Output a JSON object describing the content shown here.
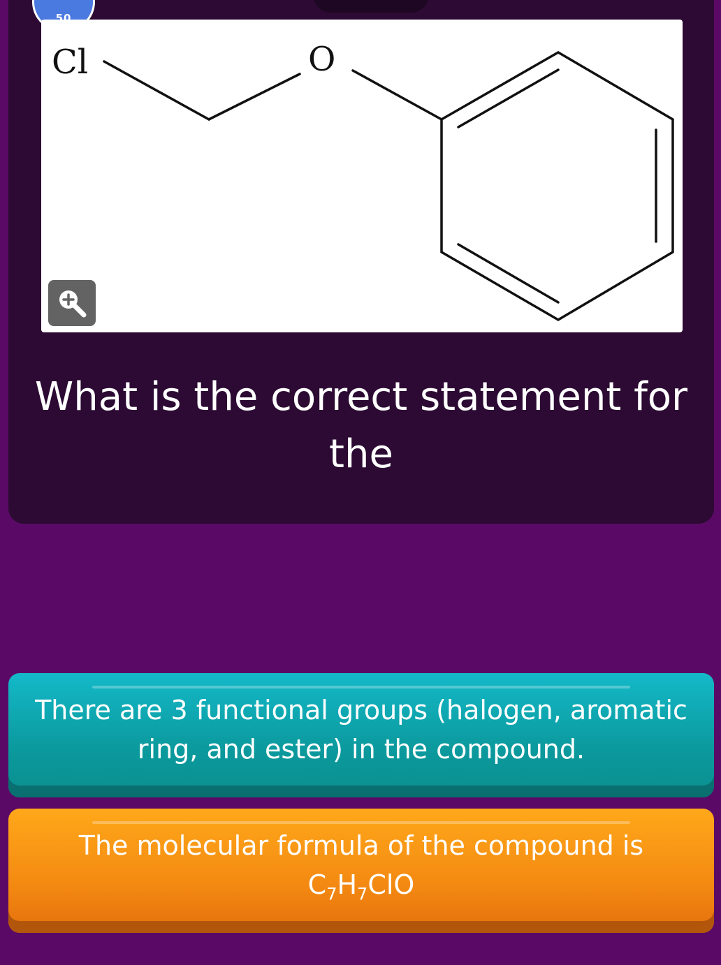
{
  "header": {
    "timer_value": "50",
    "timer_icon": "timer-icon"
  },
  "question": {
    "image": {
      "atoms": {
        "chlorine": "Cl",
        "oxygen": "O"
      },
      "zoom_icon": "zoom-in-icon"
    },
    "text": "What is the correct statement for the"
  },
  "options": [
    {
      "text": "There are 3 functional groups (halogen, aromatic ring, and ester) in the compound.",
      "color": "#0b9a9e"
    },
    {
      "text_prefix": "The molecular formula of the compound is",
      "formula": {
        "c": "C",
        "c_count": "7",
        "h": "H",
        "h_count": "7",
        "rest": "ClO"
      },
      "color": "#f48a12"
    }
  ],
  "colors": {
    "background": "#5a0a66",
    "panel": "#2c0a33",
    "timer": "#4a79e0"
  }
}
